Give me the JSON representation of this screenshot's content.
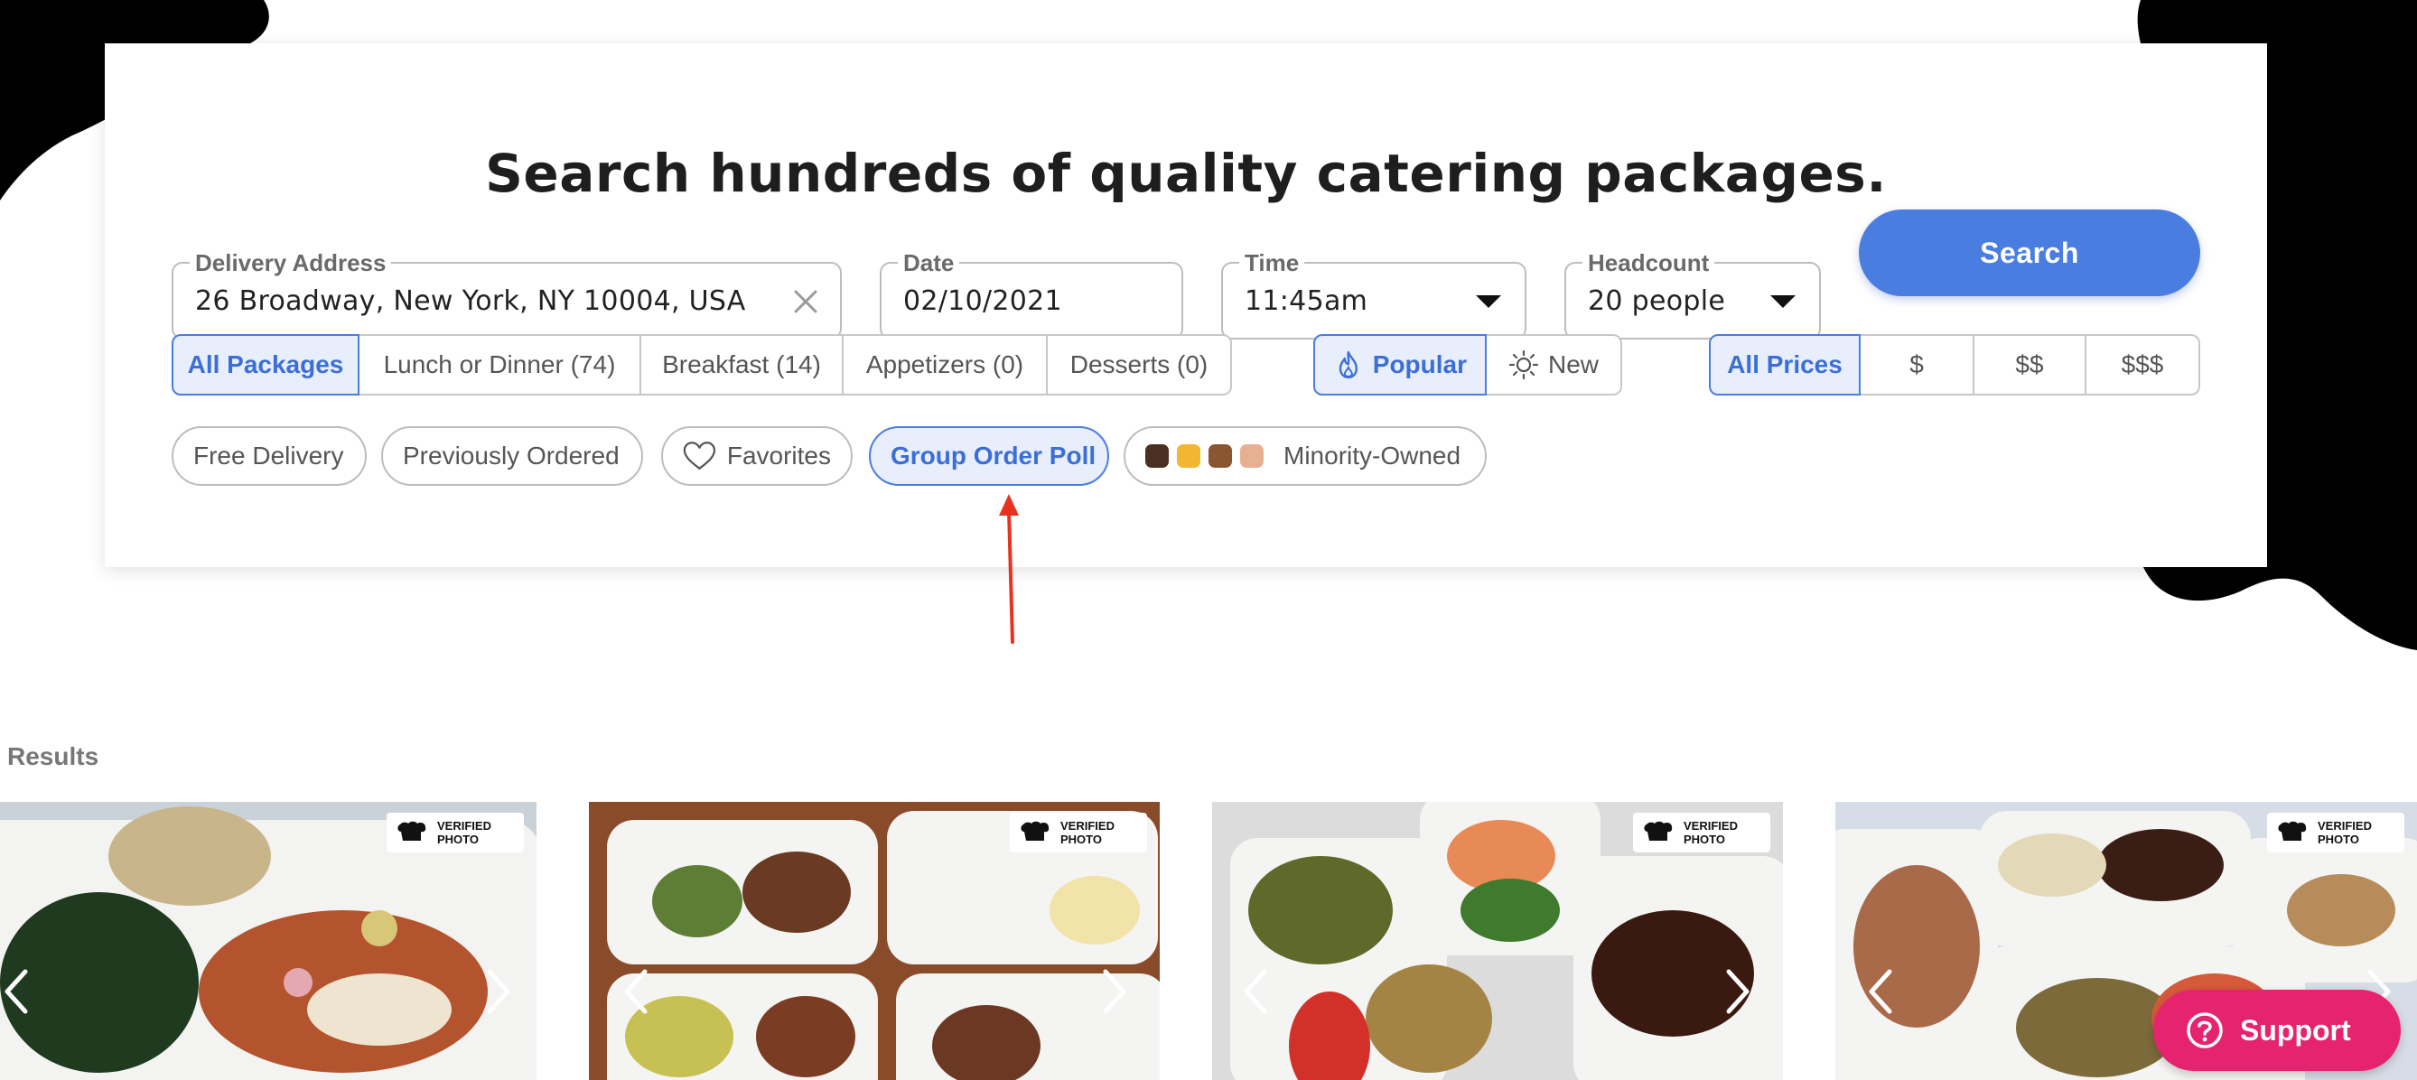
{
  "header": {
    "headline": "Search hundreds of quality catering packages."
  },
  "search_form": {
    "address": {
      "label": "Delivery Address",
      "value": "26 Broadway, New York, NY 10004, USA"
    },
    "date": {
      "label": "Date",
      "value": "02/10/2021"
    },
    "time": {
      "label": "Time",
      "value": "11:45am"
    },
    "headcount": {
      "label": "Headcount",
      "value": "20 people"
    },
    "search_label": "Search"
  },
  "categories": [
    {
      "label": "All Packages",
      "active": true
    },
    {
      "label": "Lunch or Dinner (74)",
      "active": false
    },
    {
      "label": "Breakfast (14)",
      "active": false
    },
    {
      "label": "Appetizers (0)",
      "active": false
    },
    {
      "label": "Desserts (0)",
      "active": false
    }
  ],
  "sort": [
    {
      "label": "Popular",
      "icon": "flame-icon",
      "active": true
    },
    {
      "label": "New",
      "icon": "sun-icon",
      "active": false
    }
  ],
  "prices": [
    {
      "label": "All Prices",
      "active": true
    },
    {
      "label": "$",
      "active": false
    },
    {
      "label": "$$",
      "active": false
    },
    {
      "label": "$$$",
      "active": false
    }
  ],
  "filters": [
    {
      "label": "Free Delivery",
      "active": false
    },
    {
      "label": "Previously Ordered",
      "active": false
    },
    {
      "label": "Favorites",
      "icon": "heart-icon",
      "active": false
    },
    {
      "label": "Group Order Poll",
      "active": true
    },
    {
      "label": "Minority-Owned",
      "icon": "raised-fist-emojis",
      "active": false
    }
  ],
  "results": {
    "label": "Results",
    "badge_text": "VERIFIED PHOTO"
  },
  "support": {
    "label": "Support"
  },
  "colors": {
    "accent": "#4a7de0",
    "accent_bg": "#e8eefc",
    "support": "#e6236f",
    "annotation_arrow": "#e8321f",
    "blob": "#000000"
  }
}
